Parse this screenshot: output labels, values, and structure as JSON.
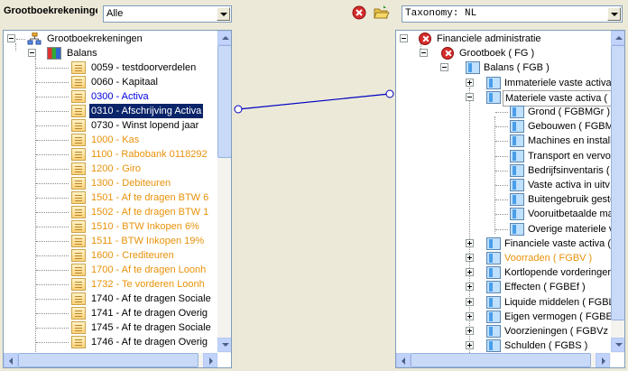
{
  "left_panel": {
    "title": "Grootboekrekeningen",
    "filter_value": "Alle",
    "tree": [
      {
        "label": "Grootboekrekeningen",
        "color": "black",
        "level": 0,
        "icon": "org-chart-icon"
      },
      {
        "label": "Balans",
        "color": "black",
        "level": 1,
        "icon": "ledger-book-icon"
      },
      {
        "label": "0059 - testdoorverdelen",
        "color": "black",
        "level": 2,
        "icon": "account-icon"
      },
      {
        "label": "0060 - Kapitaal",
        "color": "black",
        "level": 2,
        "icon": "account-icon"
      },
      {
        "label": "0300 - Activa",
        "color": "blue",
        "level": 2,
        "icon": "account-icon"
      },
      {
        "label": "0310 - Afschrijving Activa",
        "color": "selected",
        "level": 2,
        "icon": "account-icon"
      },
      {
        "label": "0730 - Winst lopend jaar",
        "color": "black",
        "level": 2,
        "icon": "account-icon"
      },
      {
        "label": "1000 - Kas",
        "color": "orange",
        "level": 2,
        "icon": "account-icon"
      },
      {
        "label": "1100 - Rabobank 0118292",
        "color": "orange",
        "level": 2,
        "icon": "account-icon"
      },
      {
        "label": "1200 - Giro",
        "color": "orange",
        "level": 2,
        "icon": "account-icon"
      },
      {
        "label": "1300 - Debiteuren",
        "color": "orange",
        "level": 2,
        "icon": "account-icon"
      },
      {
        "label": "1501 - Af te dragen BTW 6",
        "color": "orange",
        "level": 2,
        "icon": "account-icon"
      },
      {
        "label": "1502 - Af te dragen BTW 1",
        "color": "orange",
        "level": 2,
        "icon": "account-icon"
      },
      {
        "label": "1510 - BTW Inkopen 6%",
        "color": "orange",
        "level": 2,
        "icon": "account-icon"
      },
      {
        "label": "1511 - BTW Inkopen 19%",
        "color": "orange",
        "level": 2,
        "icon": "account-icon"
      },
      {
        "label": "1600 - Crediteuren",
        "color": "orange",
        "level": 2,
        "icon": "account-icon"
      },
      {
        "label": "1700 - Af te dragen Loonh",
        "color": "orange",
        "level": 2,
        "icon": "account-icon"
      },
      {
        "label": "1732 - Te vorderen Loonh",
        "color": "orange",
        "level": 2,
        "icon": "account-icon"
      },
      {
        "label": "1740 - Af te dragen Sociale",
        "color": "black",
        "level": 2,
        "icon": "account-icon"
      },
      {
        "label": "1741 - Af te dragen Overig",
        "color": "black",
        "level": 2,
        "icon": "account-icon"
      },
      {
        "label": "1745 - Af te dragen Sociale",
        "color": "black",
        "level": 2,
        "icon": "account-icon"
      },
      {
        "label": "1746 - Af te dragen Overig",
        "color": "black",
        "level": 2,
        "icon": "account-icon"
      }
    ]
  },
  "toolbar": {
    "delete_icon": "delete-link-icon",
    "open_icon": "open-folder-icon"
  },
  "right_panel": {
    "taxonomy_value": "Taxonomy: NL",
    "tree": [
      {
        "label": "Financiele administratie",
        "color": "black",
        "level": 0,
        "icon": "error-icon",
        "expander": "minus"
      },
      {
        "label": "Grootboek ( FG )",
        "color": "black",
        "level": 1,
        "icon": "error-icon",
        "expander": "minus"
      },
      {
        "label": "Balans ( FGB )",
        "color": "black",
        "level": 2,
        "icon": "taxonomy-icon",
        "expander": "minus"
      },
      {
        "label": "Immateriele vaste activa",
        "color": "black",
        "level": 3,
        "icon": "taxonomy-icon",
        "expander": "plus"
      },
      {
        "label": "Materiele vaste activa ( F",
        "color": "hover",
        "level": 3,
        "icon": "taxonomy-icon",
        "expander": "minus"
      },
      {
        "label": "Grond ( FGBMGr )",
        "color": "black",
        "level": 4,
        "icon": "taxonomy-icon",
        "expander": ""
      },
      {
        "label": "Gebouwen ( FGBMGe",
        "color": "black",
        "level": 4,
        "icon": "taxonomy-icon",
        "expander": ""
      },
      {
        "label": "Machines en install",
        "color": "black",
        "level": 4,
        "icon": "taxonomy-icon",
        "expander": ""
      },
      {
        "label": "Transport en vervo",
        "color": "black",
        "level": 4,
        "icon": "taxonomy-icon",
        "expander": ""
      },
      {
        "label": "Bedrijfsinventaris (",
        "color": "black",
        "level": 4,
        "icon": "taxonomy-icon",
        "expander": ""
      },
      {
        "label": "Vaste activa in uitv",
        "color": "black",
        "level": 4,
        "icon": "taxonomy-icon",
        "expander": ""
      },
      {
        "label": "Buitengebruik geste",
        "color": "black",
        "level": 4,
        "icon": "taxonomy-icon",
        "expander": ""
      },
      {
        "label": "Vooruitbetaalde ma",
        "color": "black",
        "level": 4,
        "icon": "taxonomy-icon",
        "expander": ""
      },
      {
        "label": "Overige materiele v",
        "color": "black",
        "level": 4,
        "icon": "taxonomy-icon",
        "expander": ""
      },
      {
        "label": "Financiele vaste activa (",
        "color": "black",
        "level": 3,
        "icon": "taxonomy-icon",
        "expander": "plus"
      },
      {
        "label": "Voorraden ( FGBV )",
        "color": "orange",
        "level": 3,
        "icon": "taxonomy-icon",
        "expander": "plus"
      },
      {
        "label": "Kortlopende vorderinger",
        "color": "black",
        "level": 3,
        "icon": "taxonomy-icon",
        "expander": "plus"
      },
      {
        "label": "Effecten ( FGBEf )",
        "color": "black",
        "level": 3,
        "icon": "taxonomy-icon",
        "expander": "plus"
      },
      {
        "label": "Liquide middelen ( FGBL",
        "color": "black",
        "level": 3,
        "icon": "taxonomy-icon",
        "expander": "plus"
      },
      {
        "label": "Eigen vermogen ( FGBE",
        "color": "black",
        "level": 3,
        "icon": "taxonomy-icon",
        "expander": "plus"
      },
      {
        "label": "Voorzieningen ( FGBVz )",
        "color": "black",
        "level": 3,
        "icon": "taxonomy-icon",
        "expander": "plus"
      },
      {
        "label": "Schulden ( FGBS )",
        "color": "black",
        "level": 3,
        "icon": "taxonomy-icon",
        "expander": "plus"
      }
    ]
  },
  "mapping_line_color": "#0000c0"
}
